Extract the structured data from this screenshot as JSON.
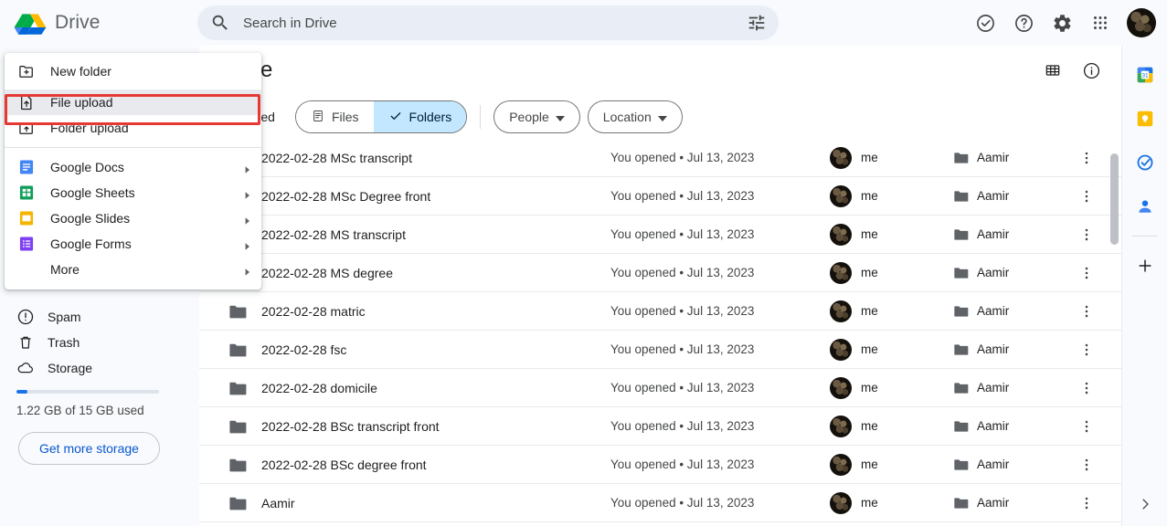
{
  "header": {
    "brand_name": "Drive",
    "logo_icon": "google-drive-logo",
    "search": {
      "placeholder": "Search in Drive",
      "value": "",
      "search_icon": "search-icon",
      "tune_icon": "tune-filter-icon"
    },
    "right_icons": [
      {
        "name": "support-checkmark-icon",
        "label": "Support"
      },
      {
        "name": "help-icon",
        "label": "Help"
      },
      {
        "name": "settings-gear-icon",
        "label": "Settings"
      },
      {
        "name": "apps-grid-icon",
        "label": "Google apps"
      }
    ],
    "avatar": {
      "name": "account-avatar",
      "label": "Google Account"
    }
  },
  "sidebar": {
    "items": [
      {
        "label": "Spam",
        "icon": "spam-exclamation-icon"
      },
      {
        "label": "Trash",
        "icon": "trash-icon"
      },
      {
        "label": "Storage",
        "icon": "cloud-storage-icon"
      }
    ],
    "storage": {
      "used_percent": 8,
      "text": "1.22 GB of 15 GB used",
      "button_label": "Get more storage",
      "accent_color": "#1a73e8"
    }
  },
  "context_menu": {
    "groups": [
      [
        {
          "label": "New folder",
          "icon": "new-folder-icon",
          "submenu": false,
          "hovered": false
        },
        {
          "label": "File upload",
          "icon": "file-upload-icon",
          "submenu": false,
          "hovered": true
        },
        {
          "label": "Folder upload",
          "icon": "folder-upload-icon",
          "submenu": false,
          "hovered": false
        }
      ],
      [
        {
          "label": "Google Docs",
          "icon": "google-docs-icon",
          "submenu": true,
          "hovered": false
        },
        {
          "label": "Google Sheets",
          "icon": "google-sheets-icon",
          "submenu": true,
          "hovered": false
        },
        {
          "label": "Google Slides",
          "icon": "google-slides-icon",
          "submenu": true,
          "hovered": false
        },
        {
          "label": "Google Forms",
          "icon": "google-forms-icon",
          "submenu": true,
          "hovered": false
        },
        {
          "label": "More",
          "icon": "none",
          "submenu": true,
          "hovered": false
        }
      ]
    ],
    "highlight_color": "#e53935",
    "highlighted_item": "File upload"
  },
  "main": {
    "page_title": "Home",
    "view_grid_icon": "grid-view-icon",
    "info_icon": "info-icon",
    "suggested_label": "Suggested",
    "chips": [
      {
        "label": "Files",
        "icon": "files-icon",
        "selected": false,
        "dropdown": false
      },
      {
        "label": "Folders",
        "icon": "check-icon",
        "selected": true,
        "dropdown": false
      },
      {
        "label": "People",
        "icon": "none",
        "selected": false,
        "dropdown": true
      },
      {
        "label": "Location",
        "icon": "none",
        "selected": false,
        "dropdown": true
      }
    ],
    "rows": [
      {
        "name": "2022-02-28 MSc transcript",
        "reason": "You opened • Jul 13, 2023",
        "owner": "me",
        "location": "Aamir"
      },
      {
        "name": "2022-02-28 MSc Degree front",
        "reason": "You opened • Jul 13, 2023",
        "owner": "me",
        "location": "Aamir"
      },
      {
        "name": "2022-02-28 MS transcript",
        "reason": "You opened • Jul 13, 2023",
        "owner": "me",
        "location": "Aamir"
      },
      {
        "name": "2022-02-28 MS degree",
        "reason": "You opened • Jul 13, 2023",
        "owner": "me",
        "location": "Aamir"
      },
      {
        "name": "2022-02-28 matric",
        "reason": "You opened • Jul 13, 2023",
        "owner": "me",
        "location": "Aamir"
      },
      {
        "name": "2022-02-28 fsc",
        "reason": "You opened • Jul 13, 2023",
        "owner": "me",
        "location": "Aamir"
      },
      {
        "name": "2022-02-28 domicile",
        "reason": "You opened • Jul 13, 2023",
        "owner": "me",
        "location": "Aamir"
      },
      {
        "name": "2022-02-28 BSc transcript front",
        "reason": "You opened • Jul 13, 2023",
        "owner": "me",
        "location": "Aamir"
      },
      {
        "name": "2022-02-28 BSc degree front",
        "reason": "You opened • Jul 13, 2023",
        "owner": "me",
        "location": "Aamir"
      },
      {
        "name": "Aamir",
        "reason": "You opened • Jul 13, 2023",
        "owner": "me",
        "location": "Aamir"
      }
    ]
  },
  "side_panel": {
    "items": [
      {
        "name": "google-calendar-icon",
        "label": "Calendar"
      },
      {
        "name": "google-keep-icon",
        "label": "Keep"
      },
      {
        "name": "google-tasks-icon",
        "label": "Tasks"
      },
      {
        "name": "google-contacts-icon",
        "label": "Contacts"
      }
    ],
    "add_label": "Get add-ons",
    "expand_icon": "chevron-right-icon"
  }
}
